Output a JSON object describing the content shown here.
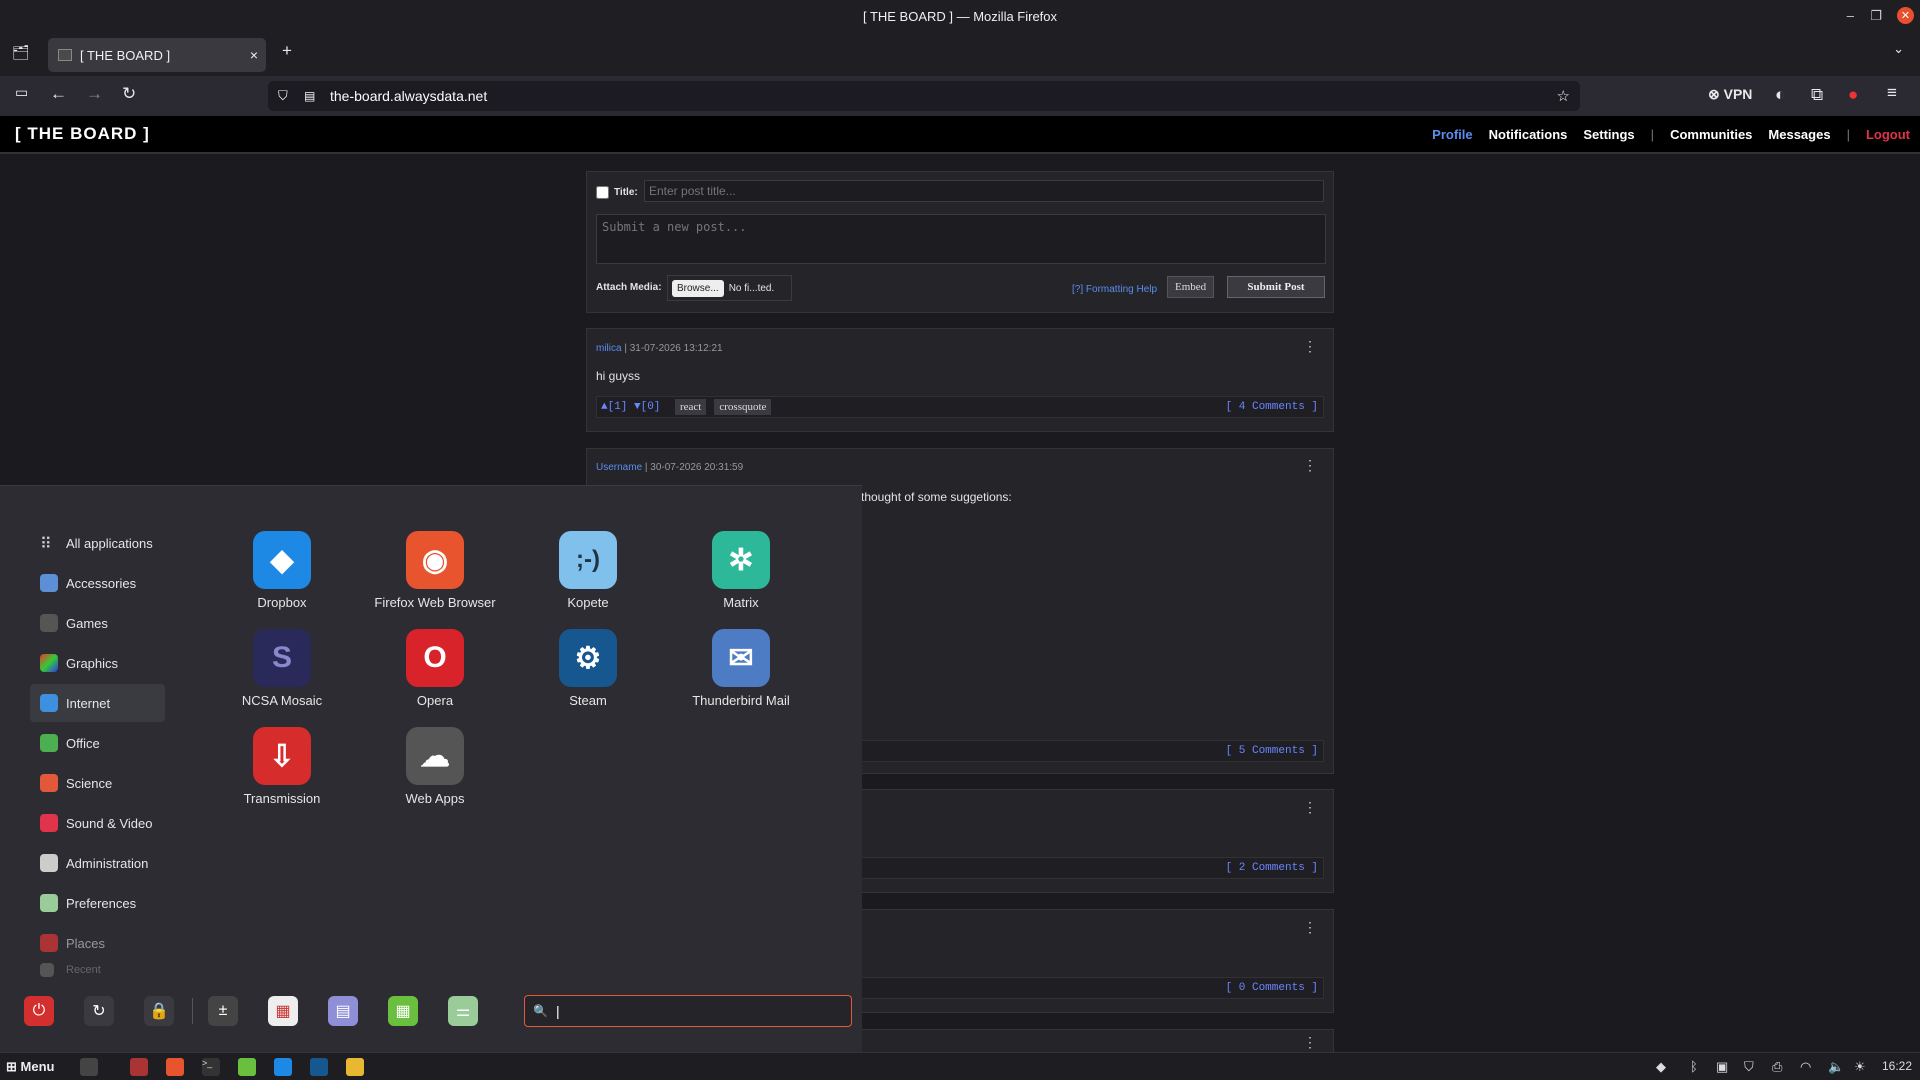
{
  "window": {
    "title": "[ THE BOARD ] — Mozilla Firefox"
  },
  "browser": {
    "tab_title": "[ THE BOARD ]",
    "url": "the-board.alwaysdata.net",
    "vpn_label": "VPN"
  },
  "site": {
    "logo": "[ THE BOARD ]",
    "nav": {
      "profile": "Profile",
      "notifications": "Notifications",
      "settings": "Settings",
      "communities": "Communities",
      "messages": "Messages",
      "logout": "Logout"
    }
  },
  "composer": {
    "title_label": "Title:",
    "title_placeholder": "Enter post title...",
    "body_placeholder": "Submit a new post...",
    "attach_label": "Attach Media:",
    "browse": "Browse...",
    "no_file": "No fi...ted.",
    "formatting_help": "[?] Formatting Help",
    "embed": "Embed",
    "submit": "Submit Post"
  },
  "posts": [
    {
      "author": "milica",
      "date": "31-07-2026 13:12:21",
      "body": "hi guyss",
      "votes": "▲[1] ▼[0]",
      "tags": [
        "react",
        "crossquote"
      ],
      "comments": "[ 4 Comments ]"
    },
    {
      "author": "Username",
      "date": "30-07-2026 20:31:59",
      "body_fragment": "thought of some suggetions:",
      "comments": "[ 5 Comments ]"
    },
    {
      "comments": "[ 2 Comments ]"
    },
    {
      "comments": "[ 0 Comments ]"
    }
  ],
  "menu": {
    "categories": [
      "All applications",
      "Accessories",
      "Games",
      "Graphics",
      "Internet",
      "Office",
      "Science",
      "Sound & Video",
      "Administration",
      "Preferences",
      "Places",
      "Recent"
    ],
    "selected": "Internet",
    "apps": [
      "Dropbox",
      "Firefox Web Browser",
      "Kopete",
      "Matrix",
      "NCSA Mosaic",
      "Opera",
      "Steam",
      "Thunderbird Mail",
      "Transmission",
      "Web Apps"
    ],
    "search_value": ""
  },
  "panel": {
    "menu_label": "Menu",
    "clock": "16:22"
  }
}
